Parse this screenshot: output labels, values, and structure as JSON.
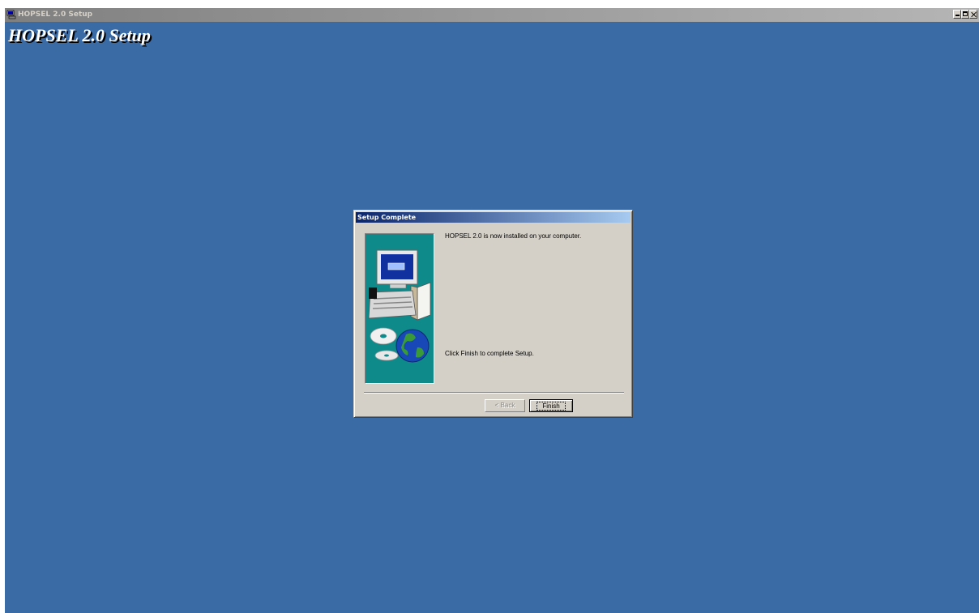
{
  "outer_window": {
    "title": "HOPSEL 2.0 Setup",
    "icon": "setup-app-icon",
    "controls": [
      "minimize-icon",
      "maximize-icon",
      "close-icon"
    ]
  },
  "heading": "HOPSEL 2.0 Setup",
  "dialog": {
    "title": "Setup Complete",
    "side_image": "computer-with-cd-and-globe-illustration",
    "message_installed": "HOPSEL 2.0 is now installed on your computer.",
    "message_finish": "Click Finish to complete Setup.",
    "back_label": "< Back",
    "finish_label": "Finish"
  },
  "colors": {
    "desktop_background": "#3b6ba5",
    "dialog_titlebar_start": "#0a246a",
    "dialog_titlebar_end": "#a6caf0",
    "side_image_background": "#0e8a8a"
  }
}
